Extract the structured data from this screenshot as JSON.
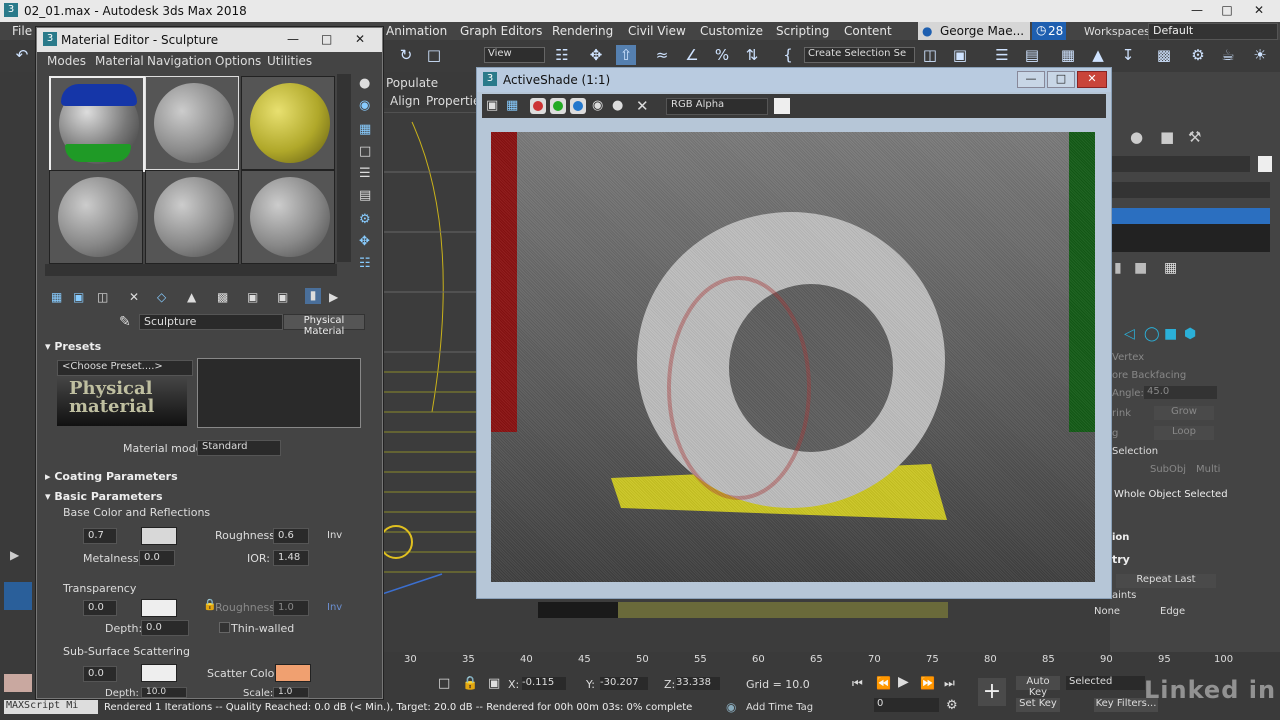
{
  "window": {
    "title": "02_01.max - Autodesk 3ds Max 2018"
  },
  "menu": {
    "file": "File",
    "items": [
      "Animation",
      "Graph Editors",
      "Rendering",
      "Civil View",
      "Customize",
      "Scripting",
      "Content"
    ],
    "user": "George Mae...",
    "notifications": "28",
    "workspaces_label": "Workspaces:",
    "workspace_value": "Default"
  },
  "toolbar": {
    "view_dropdown": "View",
    "selection_set": "Create Selection Se"
  },
  "viewport": {
    "populate_tab": "Populate",
    "align": "Align",
    "properties": "Properties"
  },
  "material_editor": {
    "title": "Material Editor - Sculpture",
    "menus": [
      "Modes",
      "Material",
      "Navigation",
      "Options",
      "Utilities"
    ],
    "material_name": "Sculpture",
    "material_type": "Physical Material",
    "presets_title": "Presets",
    "preset_dropdown": "<Choose Preset....>",
    "logo_text": "Physical material",
    "material_mode_label": "Material mode:",
    "material_mode_value": "Standard",
    "coating_title": "Coating Parameters",
    "basic_title": "Basic Parameters",
    "base_color_section": "Base Color and Reflections",
    "base_weight": "0.7",
    "roughness_label": "Roughness:",
    "roughness_value": "0.6",
    "inv_label": "Inv",
    "metalness_label": "Metalness:",
    "metalness_value": "0.0",
    "ior_label": "IOR:",
    "ior_value": "1.48",
    "transparency_section": "Transparency",
    "transparency_weight": "0.0",
    "trans_roughness_label": "Roughness:",
    "trans_roughness_value": "1.0",
    "trans_inv_label": "Inv",
    "depth_label": "Depth:",
    "depth_value": "0.0",
    "thin_walled_label": "Thin-walled",
    "sss_section": "Sub-Surface Scattering",
    "sss_weight": "0.0",
    "scatter_color_label": "Scatter Color:",
    "depth2_label": "Depth:",
    "depth2_value": "10.0",
    "scale_label": "Scale:",
    "scale_value": "1.0"
  },
  "activeshade": {
    "title": "ActiveShade (1:1)",
    "channel_dropdown": "RGB Alpha"
  },
  "command_panel": {
    "vertex": "Vertex",
    "ignore_backfacing": "ore Backfacing",
    "angle_label": "Angle:",
    "angle_value": "45.0",
    "shrink": "rink",
    "grow": "Grow",
    "ring": "g",
    "loop": "Loop",
    "soft_selection": "Selection",
    "subobj": "SubObj",
    "multi": "Multi",
    "whole_object": "Whole Object Selected",
    "section_ion": "ion",
    "section_try": "try",
    "repeat_last": "Repeat Last",
    "constraints": "aints",
    "none": "None",
    "edge": "Edge"
  },
  "timeline": {
    "ticks": [
      "30",
      "35",
      "40",
      "45",
      "50",
      "55",
      "60",
      "65",
      "70",
      "75",
      "80",
      "85",
      "90",
      "95",
      "100"
    ]
  },
  "status": {
    "x_label": "X:",
    "x_value": "-0.115",
    "y_label": "Y:",
    "y_value": "-30.207",
    "z_label": "Z:",
    "z_value": "33.338",
    "grid": "Grid = 10.0",
    "auto_key": "Auto Key",
    "selected": "Selected",
    "set_key": "Set Key",
    "key_filters": "Key Filters...",
    "frame_value": "0",
    "add_time_tag": "Add Time Tag",
    "message": "Rendered 1 Iterations -- Quality Reached: 0.0 dB (< Min.), Target: 20.0 dB -- Rendered for 00h 00m 03s: 0% complete",
    "maxscript": "MAXScript Mi"
  },
  "watermark": {
    "brand": "Linked in"
  },
  "colors": {
    "accent_blue": "#1e5fb0",
    "yellow_block": "#d9d41e",
    "red_wall": "#8a1111",
    "green_wall": "#135b16",
    "scatter_color": "#f0a070"
  }
}
